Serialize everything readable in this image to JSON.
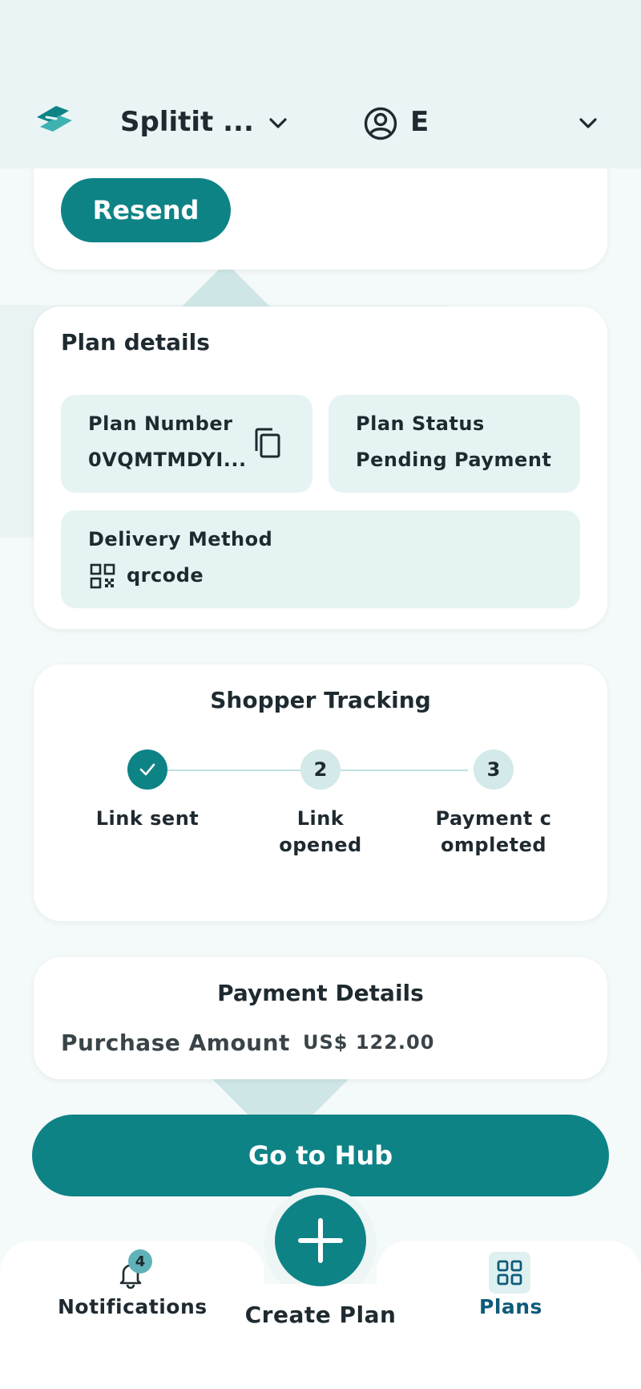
{
  "header": {
    "merchant_name": "Splitit ...",
    "user_initial": "E"
  },
  "resend_card": {
    "resend_label": "Resend"
  },
  "plan_details": {
    "title": "Plan details",
    "plan_number_label": "Plan Number",
    "plan_number_value": "0VQMTMDYI...",
    "plan_status_label": "Plan Status",
    "plan_status_value": "Pending Payment",
    "delivery_method_label": "Delivery Method",
    "delivery_method_value": "qrcode"
  },
  "shopper_tracking": {
    "title": "Shopper Tracking",
    "steps": [
      {
        "number": "1",
        "label": "Link sent",
        "state": "done"
      },
      {
        "number": "2",
        "label": "Link opened",
        "state": "pending"
      },
      {
        "number": "3",
        "label": "Payment completed",
        "state": "pending"
      }
    ]
  },
  "payment_details": {
    "title": "Payment Details",
    "purchase_amount_label": "Purchase Amount",
    "purchase_amount_value": "US$ 122.00"
  },
  "go_to_hub_label": "Go to Hub",
  "bottom_nav": {
    "notifications_label": "Notifications",
    "notifications_count": "4",
    "create_plan_label": "Create Plan",
    "plans_label": "Plans"
  },
  "colors": {
    "primary": "#0e8386",
    "tile_bg": "#e6f3f3",
    "active_nav": "#0e5a7a"
  }
}
